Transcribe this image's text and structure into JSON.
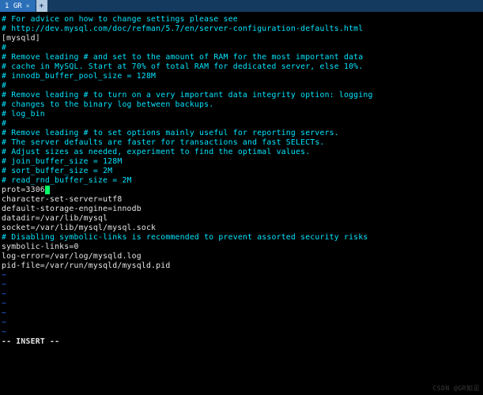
{
  "tab": {
    "label": "1 GR",
    "close_glyph": "×",
    "plus_glyph": "+"
  },
  "lines": [
    {
      "cls": "c-cyan",
      "text": "# For advice on how to change settings please see"
    },
    {
      "cls": "c-cyan",
      "text": "# http://dev.mysql.com/doc/refman/5.7/en/server-configuration-defaults.html"
    },
    {
      "cls": "c-white",
      "text": ""
    },
    {
      "cls": "c-white",
      "text": "[mysqld]"
    },
    {
      "cls": "c-cyan",
      "text": "#"
    },
    {
      "cls": "c-cyan",
      "text": "# Remove leading # and set to the amount of RAM for the most important data"
    },
    {
      "cls": "c-cyan",
      "text": "# cache in MySQL. Start at 70% of total RAM for dedicated server, else 10%."
    },
    {
      "cls": "c-cyan",
      "text": "# innodb_buffer_pool_size = 128M"
    },
    {
      "cls": "c-cyan",
      "text": "#"
    },
    {
      "cls": "c-cyan",
      "text": "# Remove leading # to turn on a very important data integrity option: logging"
    },
    {
      "cls": "c-cyan",
      "text": "# changes to the binary log between backups."
    },
    {
      "cls": "c-cyan",
      "text": "# log_bin"
    },
    {
      "cls": "c-cyan",
      "text": "#"
    },
    {
      "cls": "c-cyan",
      "text": "# Remove leading # to set options mainly useful for reporting servers."
    },
    {
      "cls": "c-cyan",
      "text": "# The server defaults are faster for transactions and fast SELECTs."
    },
    {
      "cls": "c-cyan",
      "text": "# Adjust sizes as needed, experiment to find the optimal values."
    },
    {
      "cls": "c-cyan",
      "text": "# join_buffer_size = 128M"
    },
    {
      "cls": "c-cyan",
      "text": "# sort_buffer_size = 2M"
    },
    {
      "cls": "c-cyan",
      "text": "# read_rnd_buffer_size = 2M"
    },
    {
      "cls": "c-white",
      "text": ""
    },
    {
      "cls": "c-white",
      "text": "prot=3306",
      "cursor_after": true
    },
    {
      "cls": "c-white",
      "text": "character-set-server=utf8"
    },
    {
      "cls": "c-white",
      "text": "default-storage-engine=innodb"
    },
    {
      "cls": "c-white",
      "text": ""
    },
    {
      "cls": "c-white",
      "text": "datadir=/var/lib/mysql"
    },
    {
      "cls": "c-white",
      "text": "socket=/var/lib/mysql/mysql.sock"
    },
    {
      "cls": "c-white",
      "text": ""
    },
    {
      "cls": "c-cyan",
      "text": "# Disabling symbolic-links is recommended to prevent assorted security risks"
    },
    {
      "cls": "c-white",
      "text": "symbolic-links=0"
    },
    {
      "cls": "c-white",
      "text": ""
    },
    {
      "cls": "c-white",
      "text": "log-error=/var/log/mysqld.log"
    },
    {
      "cls": "c-white",
      "text": "pid-file=/var/run/mysqld/mysqld.pid"
    },
    {
      "cls": "c-blue",
      "text": "~"
    },
    {
      "cls": "c-blue",
      "text": "~"
    },
    {
      "cls": "c-blue",
      "text": "~"
    },
    {
      "cls": "c-blue",
      "text": "~"
    },
    {
      "cls": "c-blue",
      "text": "~"
    },
    {
      "cls": "c-blue",
      "text": "~"
    },
    {
      "cls": "c-blue",
      "text": "~"
    }
  ],
  "status": "-- INSERT --",
  "watermark": "CSDN @GR知足"
}
